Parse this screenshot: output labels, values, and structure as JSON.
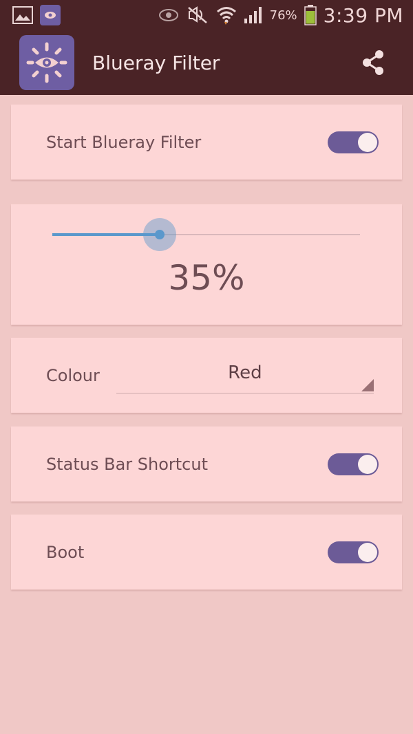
{
  "status_bar": {
    "battery_percent": "76%",
    "time": "3:39 PM",
    "icons": [
      "gallery-icon",
      "eye-app-icon",
      "eye-icon",
      "mute-icon",
      "wifi-icon",
      "signal-icon",
      "battery-icon"
    ]
  },
  "app_bar": {
    "title": "Blueray Filter",
    "logo_icon": "eye-sun-icon",
    "share_icon": "share-icon"
  },
  "settings": {
    "start_filter": {
      "label": "Start Blueray Filter",
      "enabled": true
    },
    "intensity": {
      "value": 35,
      "label": "35%"
    },
    "colour": {
      "label": "Colour",
      "selected": "Red"
    },
    "status_bar_shortcut": {
      "label": "Status Bar Shortcut",
      "enabled": true
    },
    "boot": {
      "label": "Boot",
      "enabled": true
    }
  },
  "colors": {
    "bar": "#4a2326",
    "background": "#f0c8c6",
    "card": "#fdd6d6",
    "switch_on": "#6c5b97",
    "slider_accent": "#5a98cc",
    "logo_bg": "#6e5ea3"
  }
}
